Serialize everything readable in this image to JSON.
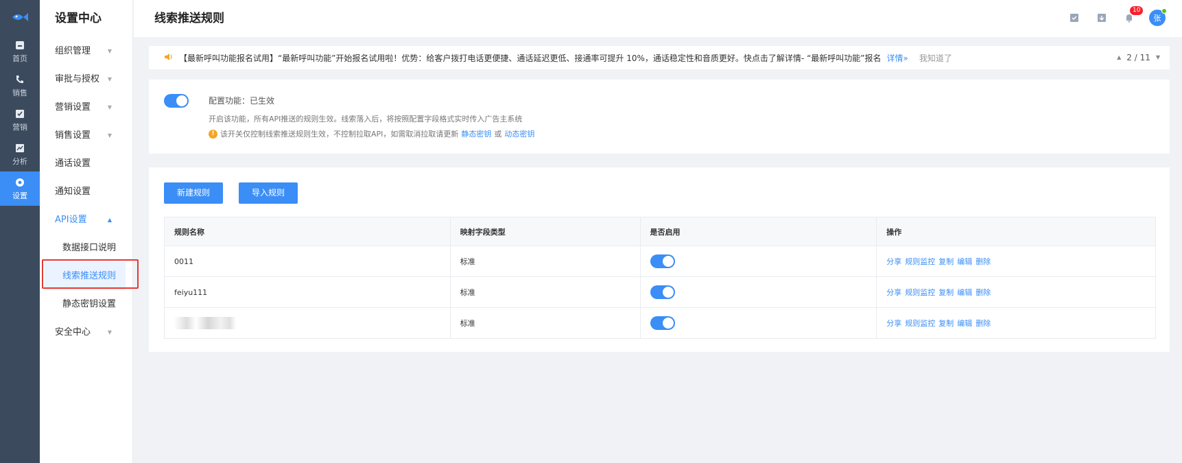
{
  "rail": {
    "items": [
      {
        "label": "首页",
        "icon": "home-icon"
      },
      {
        "label": "销售",
        "icon": "phone-icon"
      },
      {
        "label": "营销",
        "icon": "marketing-icon"
      },
      {
        "label": "分析",
        "icon": "chart-icon"
      },
      {
        "label": "设置",
        "icon": "settings-icon"
      }
    ]
  },
  "menu": {
    "title": "设置中心",
    "items": [
      {
        "label": "组织管理"
      },
      {
        "label": "审批与授权"
      },
      {
        "label": "营销设置"
      },
      {
        "label": "销售设置"
      },
      {
        "label": "通话设置"
      },
      {
        "label": "通知设置"
      },
      {
        "label": "API设置"
      },
      {
        "label": "安全中心"
      }
    ],
    "api_sub": [
      {
        "label": "数据接口说明"
      },
      {
        "label": "线索推送规则"
      },
      {
        "label": "静态密钥设置"
      }
    ]
  },
  "header": {
    "title": "线索推送规则",
    "notification_count": "10",
    "avatar_text": "张"
  },
  "notice": {
    "text": "【最新呼叫功能报名试用】“最新呼叫功能”开始报名试用啦！优势：给客户拨打电话更便捷、通话延迟更低、接通率可提升 10%，通话稳定性和音质更好。快点击了解详情- “最新呼叫功能”报名",
    "link": "详情»",
    "dismiss": "我知道了",
    "pager": "2 / 11"
  },
  "config": {
    "status": "配置功能：已生效",
    "desc": "开启该功能，所有API推送的规则生效。线索落入后，将按照配置字段格式实时传入广告主系统",
    "warn_text": "该开关仅控制线索推送规则生效，不控制拉取API，如需取消拉取请更新",
    "link1": "静态密钥",
    "or": "或",
    "link2": "动态密钥"
  },
  "rules": {
    "new_button": "新建规则",
    "import_button": "导入规则",
    "columns": [
      "规则名称",
      "映射字段类型",
      "是否启用",
      "操作"
    ],
    "rows": [
      {
        "name": "0011",
        "type": "标准",
        "enabled": true
      },
      {
        "name": "feiyu111",
        "type": "标准",
        "enabled": true
      },
      {
        "name": "",
        "type": "标准",
        "enabled": true
      }
    ],
    "ops": [
      "分享",
      "规则监控",
      "复制",
      "编辑",
      "删除"
    ]
  }
}
